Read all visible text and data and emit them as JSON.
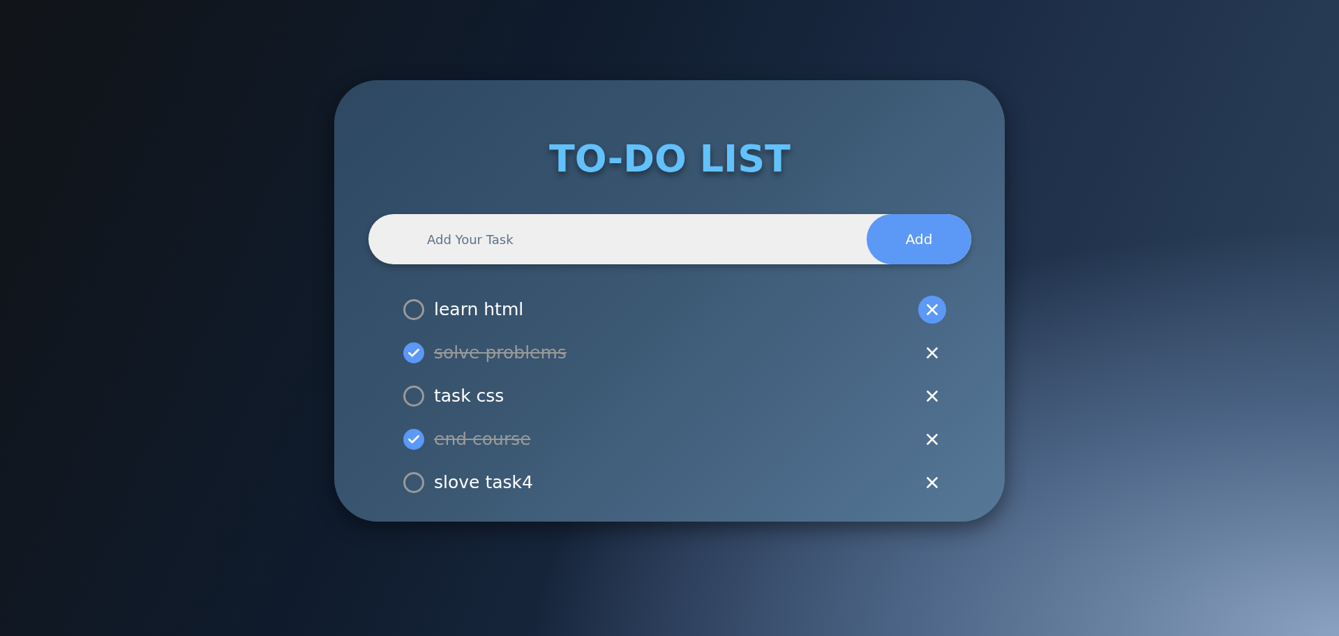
{
  "title": "TO-DO LIST",
  "task_input": {
    "placeholder": "Add Your Task"
  },
  "add_button": "Add",
  "tasks": [
    {
      "text": "learn html",
      "checked": false,
      "highlighted": true
    },
    {
      "text": "solve problems",
      "checked": true,
      "highlighted": false
    },
    {
      "text": "task css",
      "checked": false,
      "highlighted": false
    },
    {
      "text": "end course",
      "checked": true,
      "highlighted": false
    },
    {
      "text": "slove task4",
      "checked": false,
      "highlighted": false
    }
  ]
}
